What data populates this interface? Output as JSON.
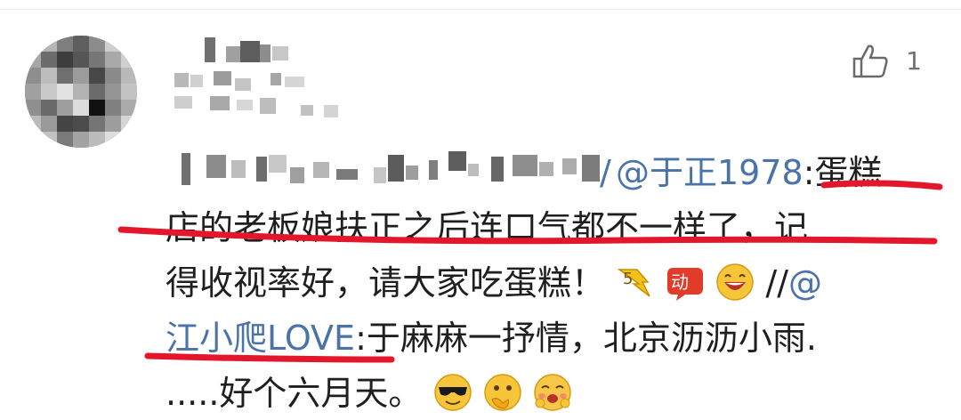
{
  "comment": {
    "mention_1": "@于正1978",
    "text_1": ":蛋糕",
    "line_2": "店的老板娘扶正之后连口气都不一样了，记",
    "line_3": "得收视率好，请大家吃蛋糕！",
    "repost_sep": " //",
    "mention_2_prefix": "@",
    "mention_2": "江小爬LOVE",
    "text_4": ":于麻麻一抒情，北京沥沥小雨.",
    "line_5": ".....好个六月天。"
  },
  "like": {
    "count": "1",
    "icon": "thumbs-up-icon"
  },
  "colors": {
    "mention": "#4a73a8",
    "annotation_red": "#e3162b",
    "text": "#1f1f1f"
  },
  "emojis": [
    "thumbsdown-yellow-icon",
    "wo-badge-icon",
    "grin-icon",
    "sunglasses-icon",
    "thinking-icon",
    "shy-icon"
  ]
}
